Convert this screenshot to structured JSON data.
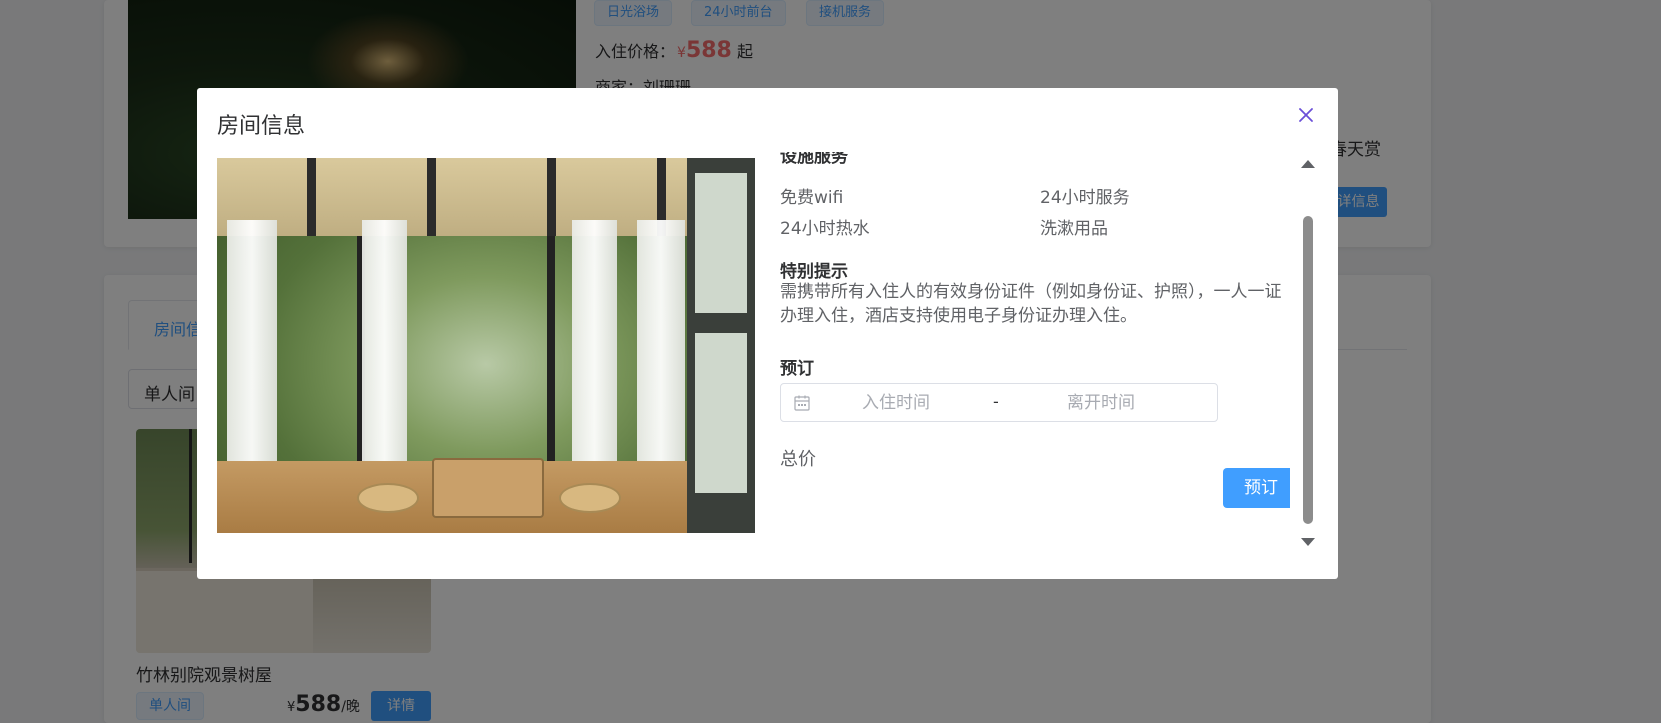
{
  "background": {
    "hotel": {
      "tags": [
        "日光浴场",
        "24小时前台",
        "接机服务"
      ],
      "price_label": "入住价格：",
      "price_currency": "¥",
      "price_value": "588",
      "price_suffix": "起",
      "merchant": "商家：刘珊珊",
      "partial_desc": "春天赏",
      "partial_button": "详信息"
    },
    "tabs": {
      "active_partial": "房间信"
    },
    "filter": {
      "selected_partial": "单人间"
    },
    "room_card": {
      "name": "竹林别院观景树屋",
      "type_tag": "单人间",
      "price_currency": "¥",
      "price_value": "588",
      "price_unit": "/晚",
      "details_button": "详情"
    }
  },
  "dialog": {
    "title": "房间信息",
    "facilities_heading": "设施服务",
    "facilities": [
      "免费wifi",
      "24小时服务",
      "24小时热水",
      "洗漱用品"
    ],
    "notice_heading": "特别提示",
    "notice_text": "需携带所有入住人的有效身份证件（例如身份证、护照），一人一证办理入住，酒店支持使用电子身份证办理入住。",
    "booking_heading": "预订",
    "checkin_placeholder": "入住时间",
    "separator": "-",
    "checkout_placeholder": "离开时间",
    "total_label": "总价",
    "book_button": "预订"
  },
  "colors": {
    "primary": "#409eff",
    "price": "#f56c6c",
    "close": "#6b4fd8"
  }
}
